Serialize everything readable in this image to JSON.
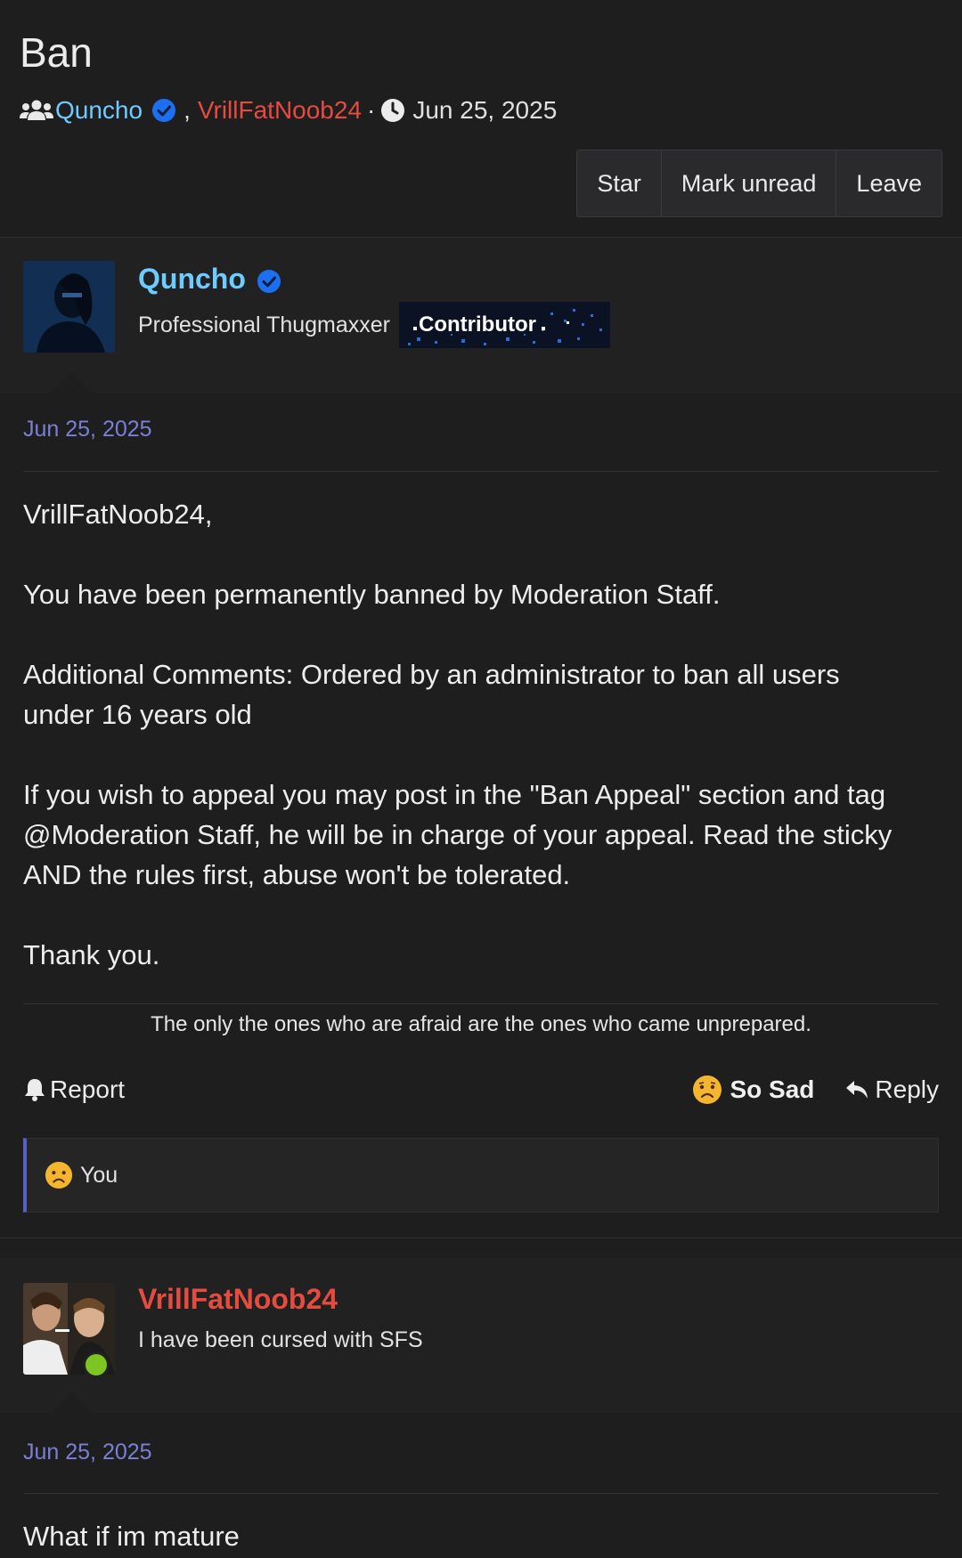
{
  "thread": {
    "title": "Ban",
    "participant_1": "Quncho",
    "participant_sep": ",",
    "participant_2": "VrillFatNoob24",
    "dot": "·",
    "date": "Jun 25, 2025"
  },
  "toolbar": {
    "star_label": "Star",
    "mark_unread_label": "Mark unread",
    "leave_label": "Leave"
  },
  "post1": {
    "author": "Quncho",
    "author_title": "Professional Thugmaxxer",
    "badge": "Contributor",
    "date": "Jun 25, 2025",
    "greeting": "VrillFatNoob24,",
    "para1": "You have been permanently banned by Moderation Staff.",
    "para2": "Additional Comments: Ordered by an administrator to ban all users under 16 years old",
    "para3": "If you wish to appeal you may post in the \"Ban Appeal\" section and tag @Moderation Staff, he will be in charge of your appeal. Read the sticky AND the rules first, abuse won't be tolerated.",
    "para4": "Thank you.",
    "signature": "The only the ones who are afraid are the ones who came unprepared.",
    "report_label": "Report",
    "reaction_label": "So Sad",
    "reply_label": "Reply",
    "reacted_by": "You"
  },
  "post2": {
    "author": "VrillFatNoob24",
    "author_title": "I have been cursed with SFS",
    "date": "Jun 25, 2025",
    "body": "What if im mature"
  },
  "colors": {
    "background": "#1e1e1f",
    "username_blue": "#6ecbff",
    "username_red": "#e54b3f",
    "date_purple": "#7b7fd6",
    "verified": "#1d6ff2",
    "online": "#7cc523"
  }
}
